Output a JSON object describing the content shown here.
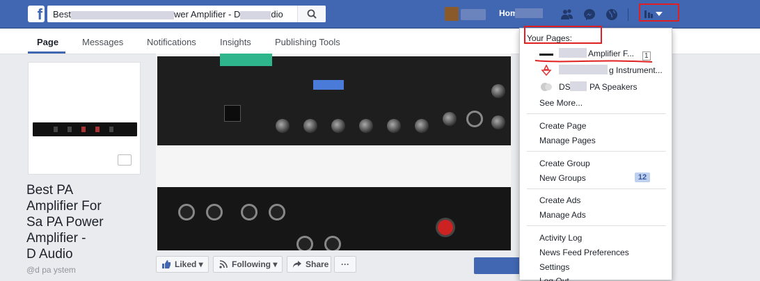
{
  "top_bar": {
    "logo": "f",
    "search_prefix": "Best",
    "search_suffix": "wer Amplifier - D",
    "search_tail": "dio",
    "home_label": "Hom",
    "icons": [
      "friends-icon",
      "messenger-icon",
      "globe-icon",
      "help-icon"
    ]
  },
  "page_nav": {
    "tabs": [
      {
        "label": "Page",
        "active": true
      },
      {
        "label": "Messages"
      },
      {
        "label": "Notifications"
      },
      {
        "label": "Insights"
      },
      {
        "label": "Publishing Tools"
      }
    ]
  },
  "profile": {
    "title": "Best PA Amplifier For Sa    PA Power Amplifier - D    Audio",
    "title_lines": [
      "Best PA",
      "Amplifier For",
      "Sa    PA Power",
      "Amplifier -",
      "D    Audio"
    ],
    "handle": "@d     pa   ystem"
  },
  "actions": {
    "liked": "Liked",
    "following": "Following",
    "share": "Share",
    "more": "···"
  },
  "menu": {
    "your_pages_header": "Your Pages:",
    "pages": [
      {
        "label": "Amplifier F...",
        "count": "1"
      },
      {
        "label": "g Instrument..."
      },
      {
        "label": "PA Speakers",
        "prefix": "DS"
      }
    ],
    "see_more": "See More...",
    "group1": [
      "Create Page",
      "Manage Pages"
    ],
    "group2_create": "Create Group",
    "group2_new": "New Groups",
    "new_groups_count": "12",
    "group3": [
      "Create Ads",
      "Manage Ads"
    ],
    "group4": [
      "Activity Log",
      "News Feed Preferences",
      "Settings",
      "Log Out"
    ]
  },
  "colors": {
    "brand": "#4267b2",
    "annotation_red": "#e02020"
  }
}
